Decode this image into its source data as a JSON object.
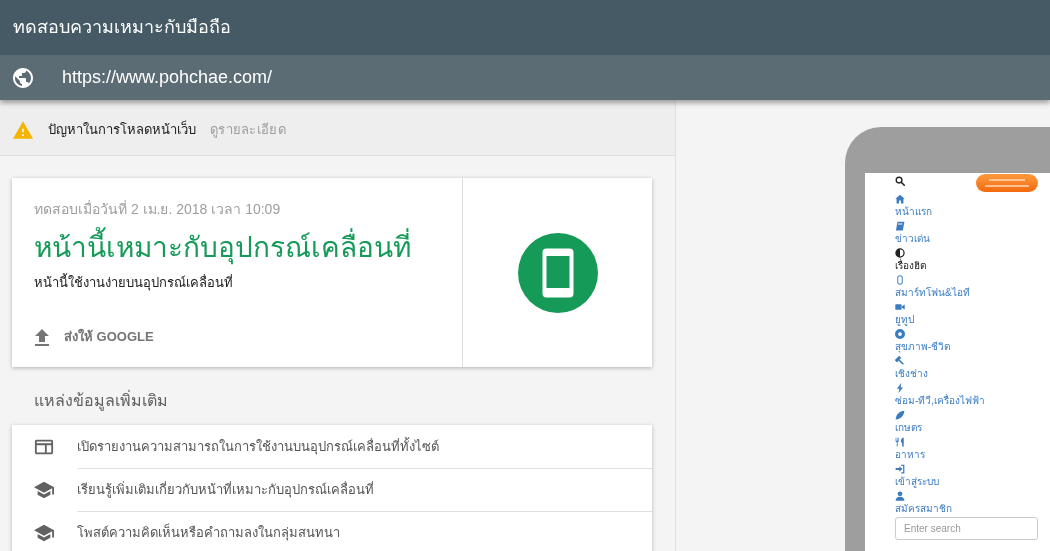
{
  "header": {
    "title": "ทดสอบความเหมาะกับมือถือ"
  },
  "url_bar": {
    "url": "https://www.pohchae.com/"
  },
  "warning": {
    "message": "ปัญหาในการโหลดหน้าเว็บ",
    "link": "ดูรายละเอียด"
  },
  "result_card": {
    "tested_at": "ทดสอบเมื่อวันที่ 2 เม.ย. 2018 เวลา 10:09",
    "headline": "หน้านี้เหมาะกับอุปกรณ์เคลื่อนที่",
    "description": "หน้านี้ใช้งานง่ายบนอุปกรณ์เคลื่อนที่",
    "action": "ส่งให้ GOOGLE"
  },
  "resources": {
    "heading": "แหล่งข้อมูลเพิ่มเติม",
    "items": [
      {
        "kind": "report",
        "label": "เปิดรายงานความสามารถในการใช้งานบนอุปกรณ์เคลื่อนที่ทั้งไซต์"
      },
      {
        "kind": "learn",
        "label": "เรียนรู้เพิ่มเติมเกี่ยวกับหน้าที่เหมาะกับอุปกรณ์เคลื่อนที่"
      },
      {
        "kind": "learn",
        "label": "โพสต์ความคิดเห็นหรือคำถามลงในกลุ่มสนทนา"
      }
    ]
  },
  "preview": {
    "menu": [
      {
        "kind": "home",
        "label": "หน้าแรก",
        "selected": false
      },
      {
        "kind": "news",
        "label": "ข่าวเด่น",
        "selected": false
      },
      {
        "kind": "trending",
        "label": "เรื่องฮิต",
        "selected": true
      },
      {
        "kind": "smartphone",
        "label": "สมาร์ทโฟน&ไอที",
        "selected": false
      },
      {
        "kind": "video",
        "label": "ยูทูป",
        "selected": false
      },
      {
        "kind": "health",
        "label": "สุขภาพ-ชีวิต",
        "selected": false
      },
      {
        "kind": "tools",
        "label": "เชิงช่าง",
        "selected": false
      },
      {
        "kind": "repair",
        "label": "ซ่อม-ทีวี,เครื่องไฟฟ้า",
        "selected": false
      },
      {
        "kind": "farm",
        "label": "เกษตร",
        "selected": false
      },
      {
        "kind": "food",
        "label": "อาหาร",
        "selected": false
      },
      {
        "kind": "login",
        "label": "เข้าสู่ระบบ",
        "selected": false
      },
      {
        "kind": "signup",
        "label": "สมัครสมาชิก",
        "selected": false
      }
    ],
    "search": {
      "placeholder": "Enter search"
    }
  }
}
